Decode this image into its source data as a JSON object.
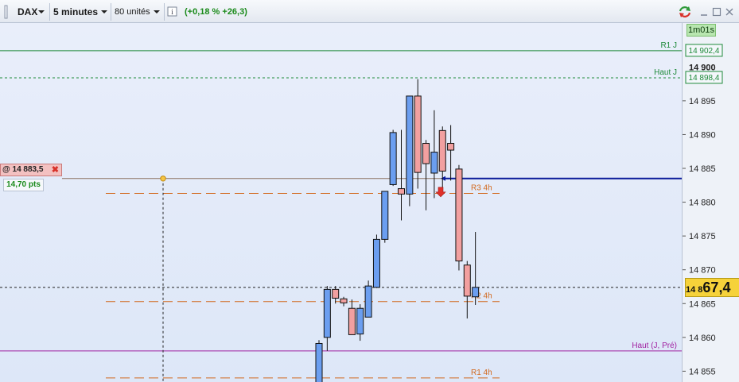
{
  "toolbar": {
    "instrument": "DAX",
    "timeframe": "5 minutes",
    "units": "80 unités",
    "info_icon": "info-icon",
    "change": "(+0,18 % +26,3)",
    "change_color": "#1a8a1a"
  },
  "scale": {
    "timer": "1m01s",
    "current_price_prefix": "14 8",
    "current_price_big": "67,4",
    "current_price": 14867.4
  },
  "order": {
    "label": "@ 14 883,5",
    "pts": "14,70 pts",
    "price": 14883.5
  },
  "chart_data": {
    "type": "candlestick",
    "instrument": "DAX",
    "timeframe": "5 minutes",
    "ylim": [
      14853.4,
      14906.5
    ],
    "y_ticks": [
      14855,
      14860,
      14865,
      14870,
      14875,
      14880,
      14885,
      14890,
      14895
    ],
    "y_tick_labels": [
      "14 855",
      "14 860",
      "14 865",
      "14 870",
      "14 875",
      "14 880",
      "14 885",
      "14 890",
      "14 895"
    ],
    "bold_tick": {
      "value": 14900,
      "label": "14 900"
    },
    "candles": [
      {
        "o": 14852.8,
        "h": 14859.6,
        "l": 14850.0,
        "c": 14859.1
      },
      {
        "o": 14860.0,
        "h": 14867.6,
        "l": 14858.0,
        "c": 14867.1
      },
      {
        "o": 14867.1,
        "h": 14867.6,
        "l": 14865.0,
        "c": 14865.8
      },
      {
        "o": 14865.7,
        "h": 14866.0,
        "l": 14864.6,
        "c": 14865.1
      },
      {
        "o": 14864.3,
        "h": 14865.6,
        "l": 14861.9,
        "c": 14860.4
      },
      {
        "o": 14860.5,
        "h": 14864.9,
        "l": 14859.5,
        "c": 14864.3
      },
      {
        "o": 14863.0,
        "h": 14868.4,
        "l": 14863.0,
        "c": 14867.6
      },
      {
        "o": 14867.4,
        "h": 14875.2,
        "l": 14867.3,
        "c": 14874.5
      },
      {
        "o": 14874.5,
        "h": 14881.6,
        "l": 14874.0,
        "c": 14881.6
      },
      {
        "o": 14882.6,
        "h": 14890.7,
        "l": 14882.4,
        "c": 14890.3
      },
      {
        "o": 14882.0,
        "h": 14890.7,
        "l": 14877.3,
        "c": 14881.2
      },
      {
        "o": 14881.2,
        "h": 14895.7,
        "l": 14879.4,
        "c": 14895.7
      },
      {
        "o": 14895.7,
        "h": 14898.2,
        "l": 14882.0,
        "c": 14884.4
      },
      {
        "o": 14888.7,
        "h": 14889.2,
        "l": 14878.8,
        "c": 14885.7
      },
      {
        "o": 14884.3,
        "h": 14893.6,
        "l": 14880.6,
        "c": 14887.4
      },
      {
        "o": 14890.6,
        "h": 14891.2,
        "l": 14881.3,
        "c": 14884.6
      },
      {
        "o": 14888.7,
        "h": 14891.4,
        "l": 14883.2,
        "c": 14887.7
      },
      {
        "o": 14884.9,
        "h": 14885.5,
        "l": 14869.9,
        "c": 14871.3
      },
      {
        "o": 14870.7,
        "h": 14871.3,
        "l": 14862.8,
        "c": 14866.1
      },
      {
        "o": 14866.0,
        "h": 14875.6,
        "l": 14864.8,
        "c": 14867.4
      }
    ],
    "levels": [
      {
        "name": "R1 J",
        "value": 14902.4,
        "value_label": "14 902,4",
        "color": "#1e8a3a",
        "style": "solid"
      },
      {
        "name": "Haut J",
        "value": 14898.4,
        "value_label": "14 898,4",
        "color": "#1e8a3a",
        "style": "dashed"
      },
      {
        "name": "R3 4h",
        "value": 14881.3,
        "color": "#d2691e",
        "style": "longdash"
      },
      {
        "name": "R2 4h",
        "value": 14865.3,
        "color": "#d2691e",
        "style": "longdash"
      },
      {
        "name": "Haut (J, Pré)",
        "value": 14858.0,
        "color": "#a020a0",
        "style": "solid"
      },
      {
        "name": "R1 4h",
        "value": 14854.0,
        "color": "#d2691e",
        "style": "longdash"
      }
    ],
    "colors": {
      "up": "#6b9ef0",
      "down": "#f2a0a0",
      "order_line": "#0a1a9a",
      "price_line": "#222222",
      "r_level": "#d2691e"
    }
  }
}
